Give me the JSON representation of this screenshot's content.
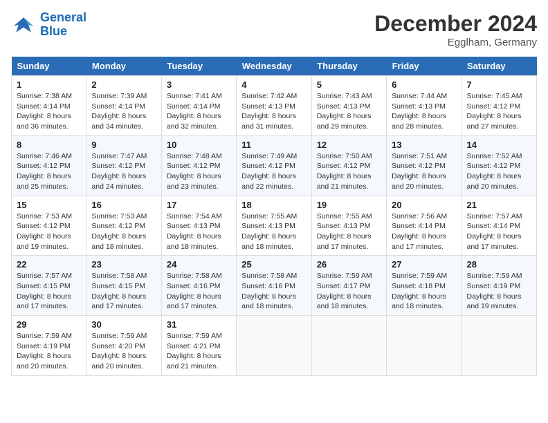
{
  "header": {
    "logo_line1": "General",
    "logo_line2": "Blue",
    "month_year": "December 2024",
    "location": "Egglham, Germany"
  },
  "weekdays": [
    "Sunday",
    "Monday",
    "Tuesday",
    "Wednesday",
    "Thursday",
    "Friday",
    "Saturday"
  ],
  "weeks": [
    [
      {
        "day": "1",
        "sunrise": "7:38 AM",
        "sunset": "4:14 PM",
        "daylight": "8 hours and 36 minutes."
      },
      {
        "day": "2",
        "sunrise": "7:39 AM",
        "sunset": "4:14 PM",
        "daylight": "8 hours and 34 minutes."
      },
      {
        "day": "3",
        "sunrise": "7:41 AM",
        "sunset": "4:14 PM",
        "daylight": "8 hours and 32 minutes."
      },
      {
        "day": "4",
        "sunrise": "7:42 AM",
        "sunset": "4:13 PM",
        "daylight": "8 hours and 31 minutes."
      },
      {
        "day": "5",
        "sunrise": "7:43 AM",
        "sunset": "4:13 PM",
        "daylight": "8 hours and 29 minutes."
      },
      {
        "day": "6",
        "sunrise": "7:44 AM",
        "sunset": "4:13 PM",
        "daylight": "8 hours and 28 minutes."
      },
      {
        "day": "7",
        "sunrise": "7:45 AM",
        "sunset": "4:12 PM",
        "daylight": "8 hours and 27 minutes."
      }
    ],
    [
      {
        "day": "8",
        "sunrise": "7:46 AM",
        "sunset": "4:12 PM",
        "daylight": "8 hours and 25 minutes."
      },
      {
        "day": "9",
        "sunrise": "7:47 AM",
        "sunset": "4:12 PM",
        "daylight": "8 hours and 24 minutes."
      },
      {
        "day": "10",
        "sunrise": "7:48 AM",
        "sunset": "4:12 PM",
        "daylight": "8 hours and 23 minutes."
      },
      {
        "day": "11",
        "sunrise": "7:49 AM",
        "sunset": "4:12 PM",
        "daylight": "8 hours and 22 minutes."
      },
      {
        "day": "12",
        "sunrise": "7:50 AM",
        "sunset": "4:12 PM",
        "daylight": "8 hours and 21 minutes."
      },
      {
        "day": "13",
        "sunrise": "7:51 AM",
        "sunset": "4:12 PM",
        "daylight": "8 hours and 20 minutes."
      },
      {
        "day": "14",
        "sunrise": "7:52 AM",
        "sunset": "4:12 PM",
        "daylight": "8 hours and 20 minutes."
      }
    ],
    [
      {
        "day": "15",
        "sunrise": "7:53 AM",
        "sunset": "4:12 PM",
        "daylight": "8 hours and 19 minutes."
      },
      {
        "day": "16",
        "sunrise": "7:53 AM",
        "sunset": "4:12 PM",
        "daylight": "8 hours and 18 minutes."
      },
      {
        "day": "17",
        "sunrise": "7:54 AM",
        "sunset": "4:13 PM",
        "daylight": "8 hours and 18 minutes."
      },
      {
        "day": "18",
        "sunrise": "7:55 AM",
        "sunset": "4:13 PM",
        "daylight": "8 hours and 18 minutes."
      },
      {
        "day": "19",
        "sunrise": "7:55 AM",
        "sunset": "4:13 PM",
        "daylight": "8 hours and 17 minutes."
      },
      {
        "day": "20",
        "sunrise": "7:56 AM",
        "sunset": "4:14 PM",
        "daylight": "8 hours and 17 minutes."
      },
      {
        "day": "21",
        "sunrise": "7:57 AM",
        "sunset": "4:14 PM",
        "daylight": "8 hours and 17 minutes."
      }
    ],
    [
      {
        "day": "22",
        "sunrise": "7:57 AM",
        "sunset": "4:15 PM",
        "daylight": "8 hours and 17 minutes."
      },
      {
        "day": "23",
        "sunrise": "7:58 AM",
        "sunset": "4:15 PM",
        "daylight": "8 hours and 17 minutes."
      },
      {
        "day": "24",
        "sunrise": "7:58 AM",
        "sunset": "4:16 PM",
        "daylight": "8 hours and 17 minutes."
      },
      {
        "day": "25",
        "sunrise": "7:58 AM",
        "sunset": "4:16 PM",
        "daylight": "8 hours and 18 minutes."
      },
      {
        "day": "26",
        "sunrise": "7:59 AM",
        "sunset": "4:17 PM",
        "daylight": "8 hours and 18 minutes."
      },
      {
        "day": "27",
        "sunrise": "7:59 AM",
        "sunset": "4:18 PM",
        "daylight": "8 hours and 18 minutes."
      },
      {
        "day": "28",
        "sunrise": "7:59 AM",
        "sunset": "4:19 PM",
        "daylight": "8 hours and 19 minutes."
      }
    ],
    [
      {
        "day": "29",
        "sunrise": "7:59 AM",
        "sunset": "4:19 PM",
        "daylight": "8 hours and 20 minutes."
      },
      {
        "day": "30",
        "sunrise": "7:59 AM",
        "sunset": "4:20 PM",
        "daylight": "8 hours and 20 minutes."
      },
      {
        "day": "31",
        "sunrise": "7:59 AM",
        "sunset": "4:21 PM",
        "daylight": "8 hours and 21 minutes."
      },
      null,
      null,
      null,
      null
    ]
  ],
  "labels": {
    "sunrise": "Sunrise:",
    "sunset": "Sunset:",
    "daylight": "Daylight:"
  }
}
